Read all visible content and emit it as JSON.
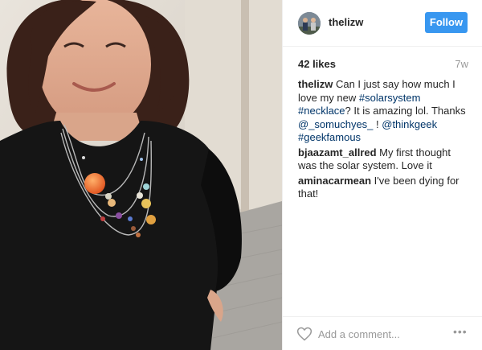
{
  "post": {
    "username": "thelizw",
    "follow_label": "Follow",
    "likes": "42 likes",
    "time_ago": "7w"
  },
  "comments": [
    {
      "author": "thelizw",
      "parts": [
        {
          "text": " Can I just say how much I love my new ",
          "tag": false
        },
        {
          "text": "#solarsystem",
          "tag": true
        },
        {
          "text": " ",
          "tag": false
        },
        {
          "text": "#necklace",
          "tag": true
        },
        {
          "text": "? It is amazing lol. Thanks ",
          "tag": false
        },
        {
          "text": "@_somuchyes_",
          "tag": true
        },
        {
          "text": " ! ",
          "tag": false
        },
        {
          "text": "@thinkgeek",
          "tag": true
        },
        {
          "text": " ",
          "tag": false
        },
        {
          "text": "#geekfamous",
          "tag": true
        }
      ]
    },
    {
      "author": "bjaazamt_allred",
      "parts": [
        {
          "text": " My first thought was the solar system. Love it",
          "tag": false
        }
      ]
    },
    {
      "author": "aminacarmean",
      "parts": [
        {
          "text": " I've been dying for that!",
          "tag": false
        }
      ]
    }
  ],
  "add_comment": {
    "placeholder": "Add a comment...",
    "more_label": "•••"
  },
  "icons": {
    "heart": "heart-icon",
    "more": "more-options-icon",
    "avatar": "avatar"
  },
  "colors": {
    "follow_button": "#3897f0",
    "hashtag": "#003569",
    "muted": "#999999",
    "border": "#efefef"
  }
}
